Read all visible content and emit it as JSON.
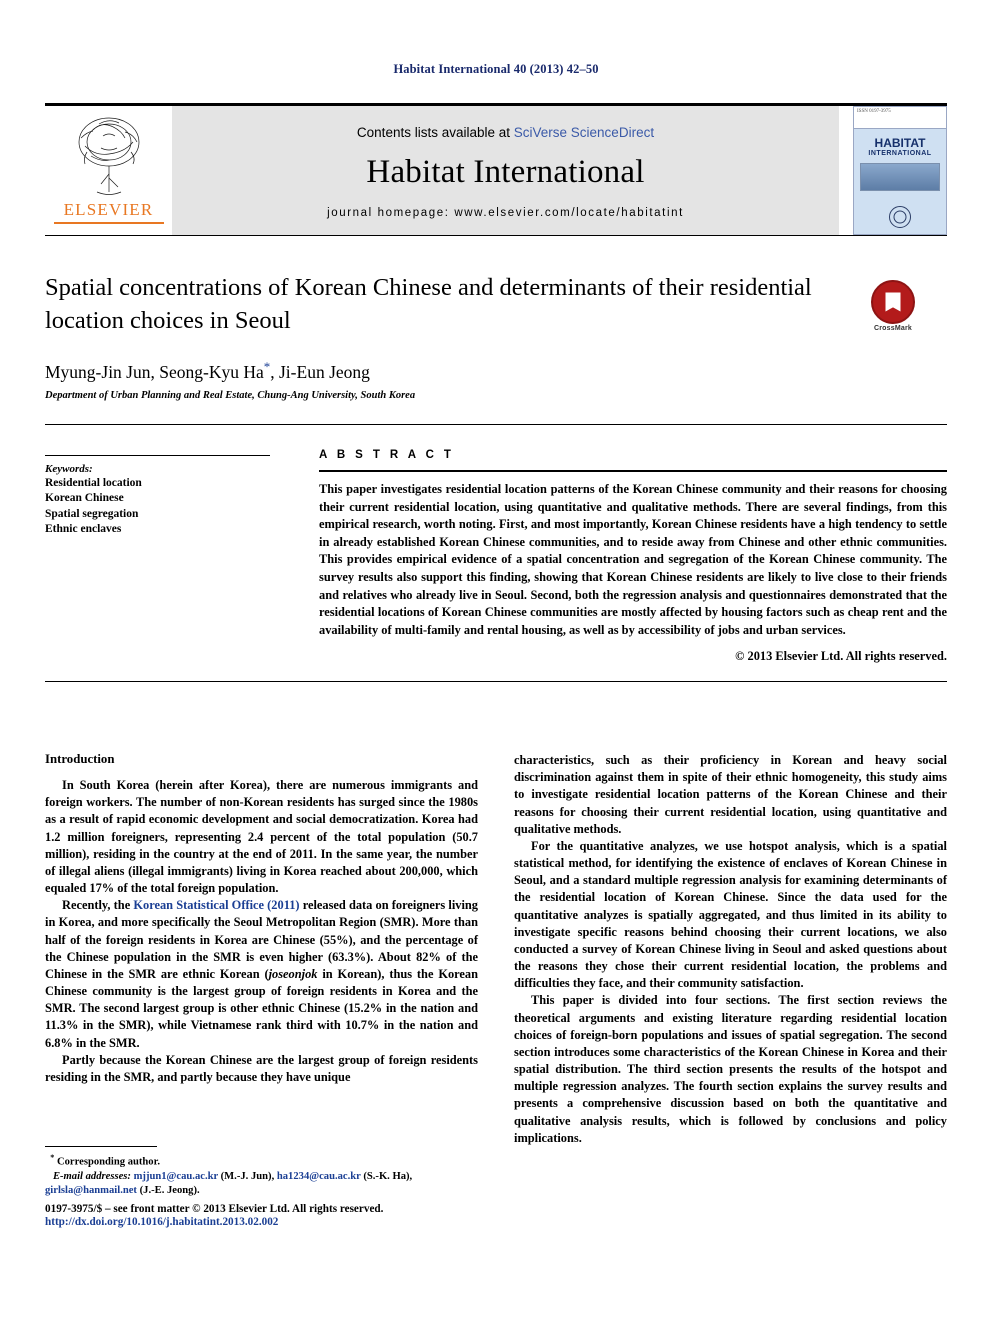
{
  "running_head": "Habitat International 40 (2013) 42–50",
  "masthead": {
    "contents_prefix": "Contents lists available at ",
    "sciencedirect": "SciVerse ScienceDirect",
    "journal_name": "Habitat International",
    "homepage": "journal homepage: www.elsevier.com/locate/habitatint",
    "publisher": "ELSEVIER",
    "cover": {
      "title": "HABITAT",
      "subtitle": "INTERNATIONAL",
      "corner_note": "ISSN 0197-3975"
    }
  },
  "article": {
    "title": "Spatial concentrations of Korean Chinese and determinants of their residential location choices in Seoul",
    "authors": "Myung-Jin Jun, Seong-Kyu Ha",
    "authors_tail": ", Ji-Eun Jeong",
    "corresponding_marker": "*",
    "affiliation": "Department of Urban Planning and Real Estate, Chung-Ang University, South Korea",
    "crossmark_label": "CrossMark"
  },
  "keywords": {
    "heading": "Keywords:",
    "items": [
      "Residential location",
      "Korean Chinese",
      "Spatial segregation",
      "Ethnic enclaves"
    ]
  },
  "abstract": {
    "heading": "A B S T R A C T",
    "text": "This paper investigates residential location patterns of the Korean Chinese community and their reasons for choosing their current residential location, using quantitative and qualitative methods. There are several findings, from this empirical research, worth noting. First, and most importantly, Korean Chinese residents have a high tendency to settle in already established Korean Chinese communities, and to reside away from Chinese and other ethnic communities. This provides empirical evidence of a spatial concentration and segregation of the Korean Chinese community. The survey results also support this finding, showing that Korean Chinese residents are likely to live close to their friends and relatives who already live in Seoul. Second, both the regression analysis and questionnaires demonstrated that the residential locations of Korean Chinese communities are mostly affected by housing factors such as cheap rent and the availability of multi-family and rental housing, as well as by accessibility of jobs and urban services.",
    "copyright": "© 2013 Elsevier Ltd. All rights reserved."
  },
  "body": {
    "section_heading": "Introduction",
    "left_paragraphs": [
      "In South Korea (herein after Korea), there are numerous immigrants and foreign workers. The number of non-Korean residents has surged since the 1980s as a result of rapid economic development and social democratization. Korea had 1.2 million foreigners, representing 2.4 percent of the total population (50.7 million), residing in the country at the end of 2011. In the same year, the number of illegal aliens (illegal immigrants) living in Korea reached about 200,000, which equaled 17% of the total foreign population."
    ],
    "para2_pre": "Recently, the ",
    "para2_link": "Korean Statistical Office (2011)",
    "para2_post": " released data on foreigners living in Korea, and more specifically the Seoul Metropolitan Region (SMR). More than half of the foreign residents in Korea are Chinese (55%), and the percentage of the Chinese population in the SMR is even higher (63.3%). About 82% of the Chinese in the SMR are ethnic Korean (",
    "para2_italic": "joseonjok",
    "para2_post2": " in Korean), thus the Korean Chinese community is the largest group of foreign residents in Korea and the SMR. The second largest group is other ethnic Chinese (15.2% in the nation and 11.3% in the SMR), while Vietnamese rank third with 10.7% in the nation and 6.8% in the SMR.",
    "para3": "Partly because the Korean Chinese are the largest group of foreign residents residing in the SMR, and partly because they have unique",
    "right_paragraphs": [
      "characteristics, such as their proficiency in Korean and heavy social discrimination against them in spite of their ethnic homogeneity, this study aims to investigate residential location patterns of the Korean Chinese and their reasons for choosing their current residential location, using quantitative and qualitative methods.",
      "For the quantitative analyzes, we use hotspot analysis, which is a spatial statistical method, for identifying the existence of enclaves of Korean Chinese in Seoul, and a standard multiple regression analysis for examining determinants of the residential location of Korean Chinese. Since the data used for the quantitative analyzes is spatially aggregated, and thus limited in its ability to investigate specific reasons behind choosing their current locations, we also conducted a survey of Korean Chinese living in Seoul and asked questions about the reasons they chose their current residential location, the problems and difficulties they face, and their community satisfaction.",
      "This paper is divided into four sections. The first section reviews the theoretical arguments and existing literature regarding residential location choices of foreign-born populations and issues of spatial segregation. The second section introduces some characteristics of the Korean Chinese in Korea and their spatial distribution. The third section presents the results of the hotspot and multiple regression analyzes. The fourth section explains the survey results and presents a comprehensive discussion based on both the quantitative and qualitative analysis results, which is followed by conclusions and policy implications."
    ]
  },
  "footnote": {
    "corresponding": "Corresponding author.",
    "email_label": "E-mail addresses:",
    "emails": [
      {
        "address": "mjjun1@cau.ac.kr",
        "person": "(M.-J. Jun)"
      },
      {
        "address": "ha1234@cau.ac.kr",
        "person": "(S.-K. Ha)"
      },
      {
        "address": "girlsla@hanmail.net",
        "person": "(J.-E. Jeong)"
      }
    ]
  },
  "footer": {
    "front_matter": "0197-3975/$ – see front matter © 2013 Elsevier Ltd. All rights reserved.",
    "doi": "http://dx.doi.org/10.1016/j.habitatint.2013.02.002"
  }
}
